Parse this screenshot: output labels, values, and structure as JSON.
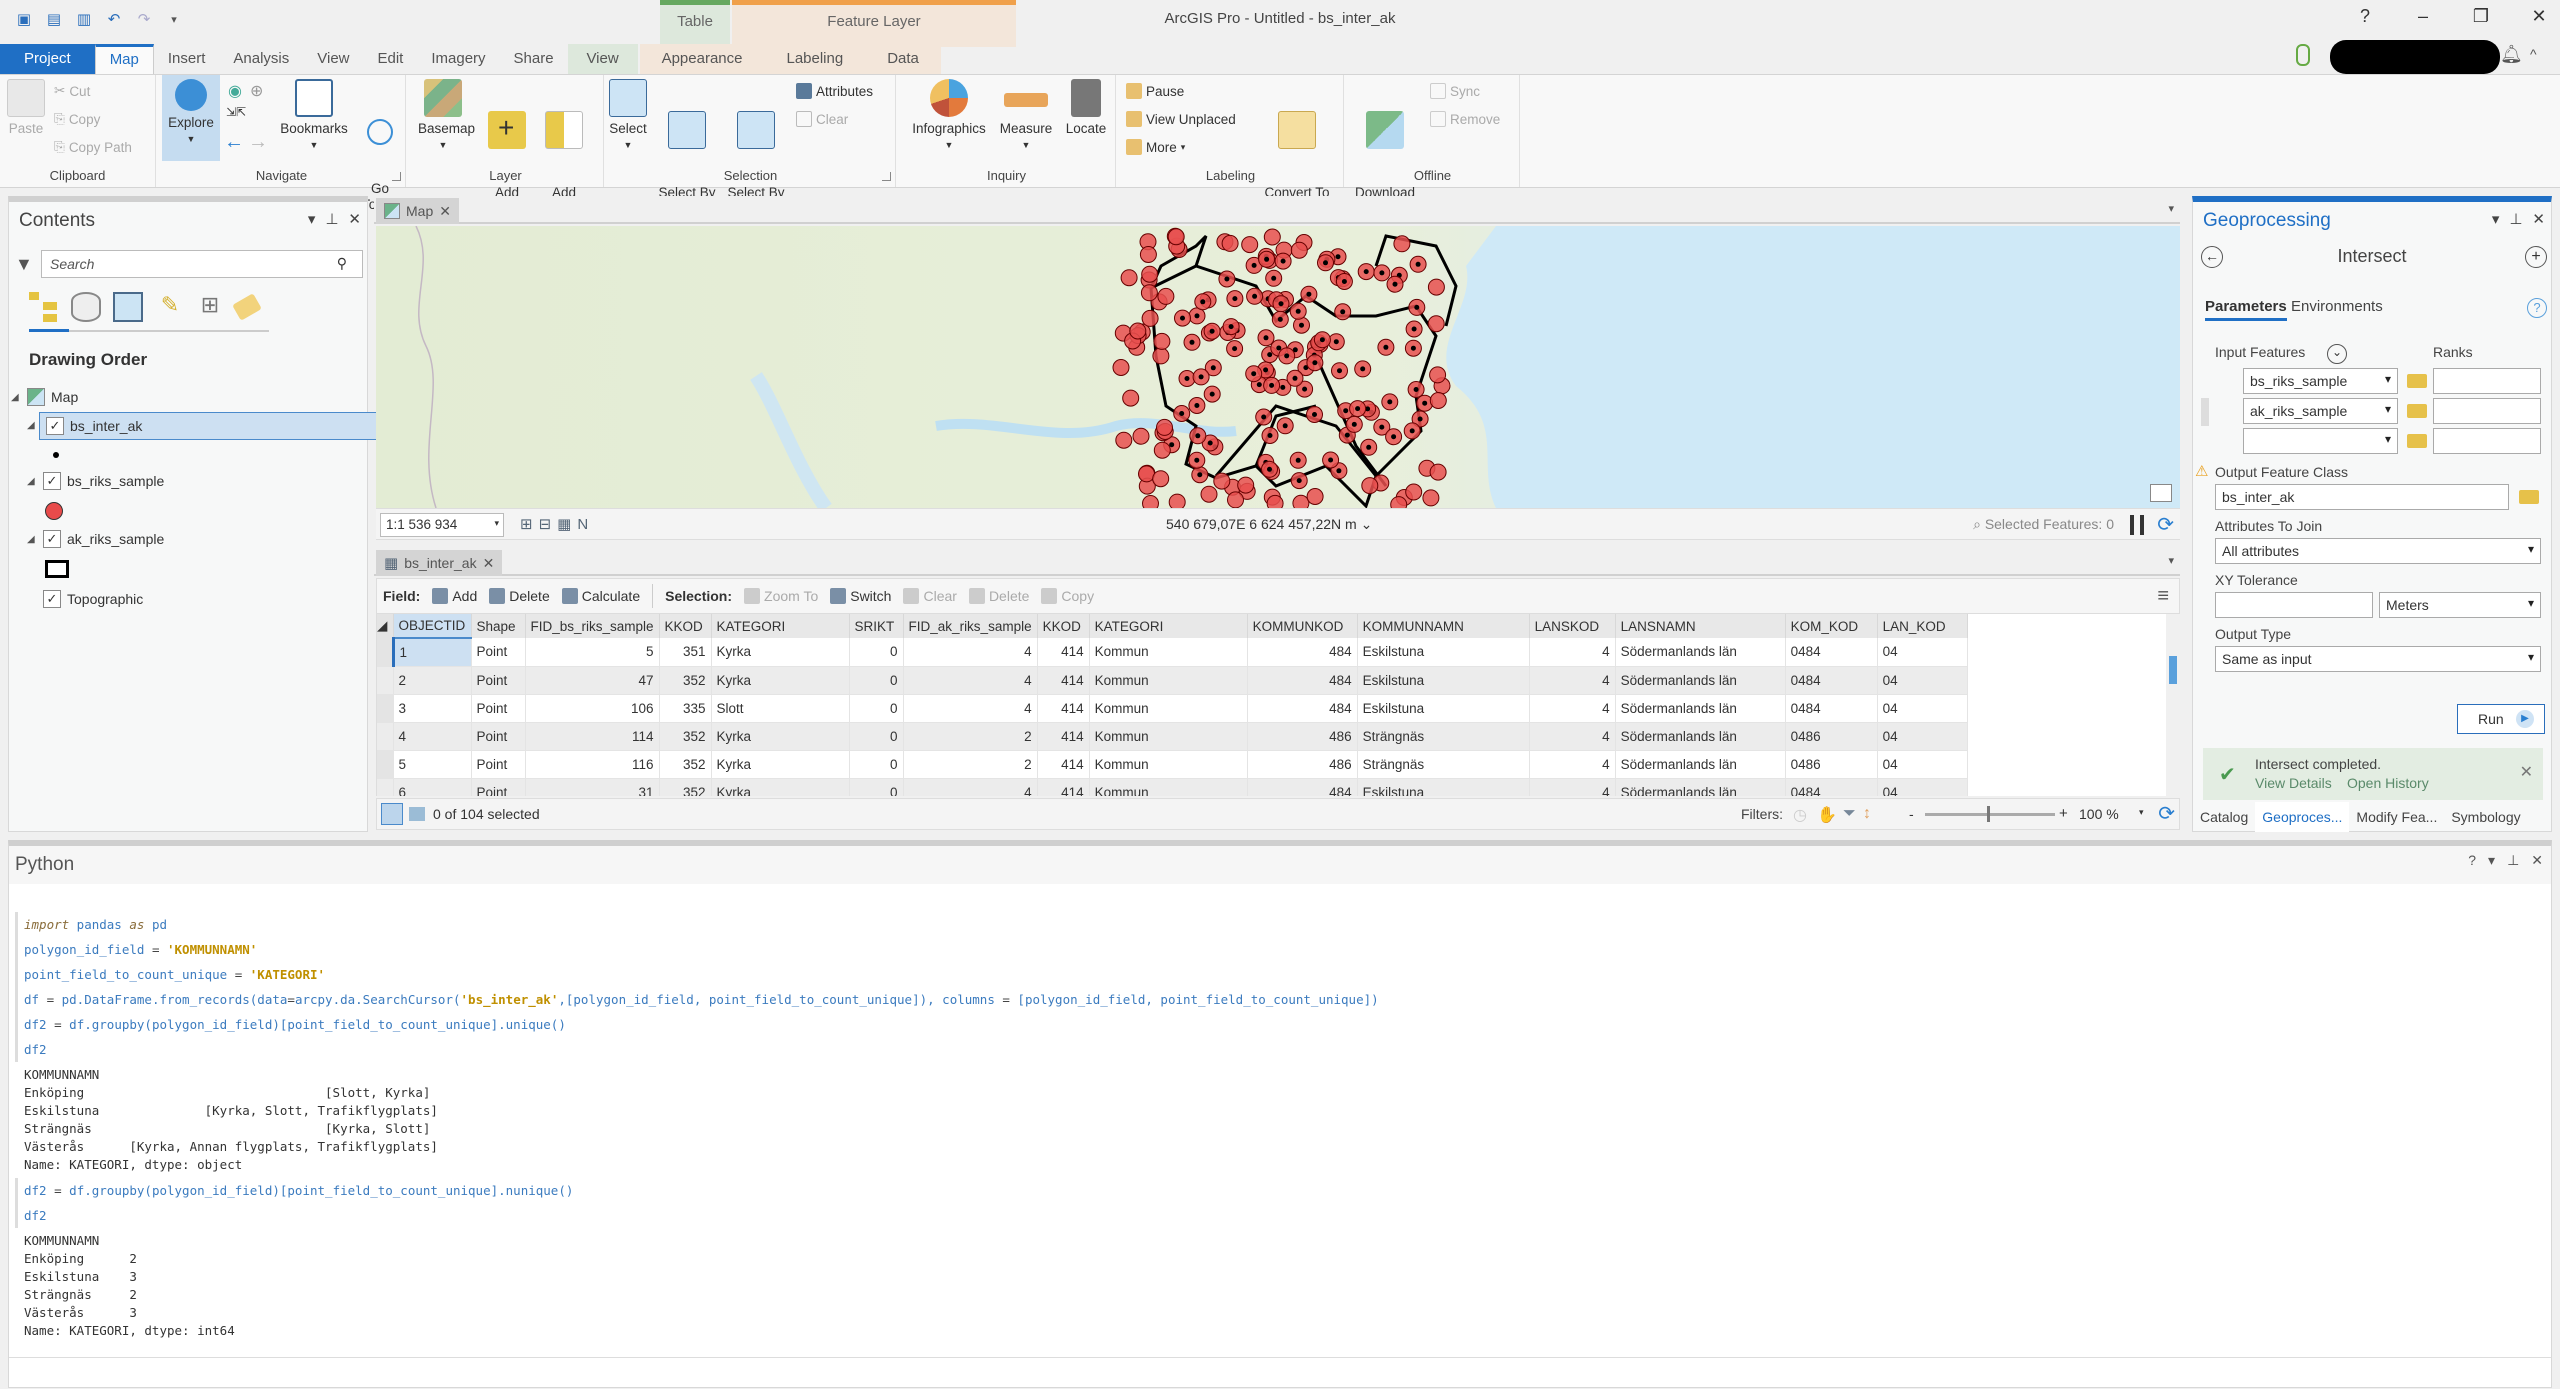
{
  "window": {
    "title": "ArcGIS Pro - Untitled - bs_inter_ak",
    "controls": [
      "?",
      "–",
      "❐",
      "✕"
    ]
  },
  "contextual_headers": {
    "table": "Table",
    "feature_layer": "Feature Layer"
  },
  "ribbon_tabs": [
    {
      "label": "Project"
    },
    {
      "label": "Map"
    },
    {
      "label": "Insert"
    },
    {
      "label": "Analysis"
    },
    {
      "label": "View"
    },
    {
      "label": "Edit"
    },
    {
      "label": "Imagery"
    },
    {
      "label": "Share"
    },
    {
      "label": "View"
    },
    {
      "label": "Appearance"
    },
    {
      "label": "Labeling"
    },
    {
      "label": "Data"
    }
  ],
  "ribbon": {
    "clipboard": {
      "label": "Clipboard",
      "paste": "Paste",
      "cut": "Cut",
      "copy": "Copy",
      "copy_path": "Copy Path"
    },
    "navigate": {
      "label": "Navigate",
      "explore": "Explore",
      "bookmarks": "Bookmarks",
      "go_to_xy": "Go\nTo XY"
    },
    "layer": {
      "label": "Layer",
      "basemap": "Basemap",
      "add_data": "Add\nData",
      "add_preset": "Add\nPreset"
    },
    "selection": {
      "label": "Selection",
      "select": "Select",
      "select_by_attributes": "Select By\nAttributes",
      "select_by_location": "Select By\nLocation",
      "attributes": "Attributes",
      "clear": "Clear"
    },
    "inquiry": {
      "label": "Inquiry",
      "infographics": "Infographics",
      "measure": "Measure",
      "locate": "Locate"
    },
    "labeling": {
      "label": "Labeling",
      "pause": "Pause",
      "view_unplaced": "View Unplaced",
      "more": "More",
      "convert": "Convert To\nAnnotation"
    },
    "offline": {
      "label": "Offline",
      "download_map": "Download\nMap",
      "sync": "Sync",
      "remove": "Remove"
    }
  },
  "contents": {
    "title": "Contents",
    "search_placeholder": "Search",
    "heading": "Drawing Order",
    "map_label": "Map",
    "layers": [
      {
        "name": "bs_inter_ak",
        "checked": true,
        "selected": true
      },
      {
        "name": "bs_riks_sample",
        "checked": true
      },
      {
        "name": "ak_riks_sample",
        "checked": true
      },
      {
        "name": "Topographic",
        "checked": true
      }
    ]
  },
  "map_view": {
    "tab_label": "Map",
    "scale": "1:1 536 934",
    "coordinates": "540 679,07E 6 624 457,22N m",
    "selected_features": "Selected Features: 0"
  },
  "table_view": {
    "tab_label": "bs_inter_ak",
    "toolbar": {
      "field_label": "Field:",
      "add": "Add",
      "delete": "Delete",
      "calculate": "Calculate",
      "selection_label": "Selection:",
      "zoom_to": "Zoom To",
      "switch": "Switch",
      "clear": "Clear",
      "sel_delete": "Delete",
      "copy": "Copy"
    },
    "columns": [
      "OBJECTID",
      "Shape",
      "FID_bs_riks_sample",
      "KKOD",
      "KATEGORI",
      "SRIKT",
      "FID_ak_riks_sample",
      "KKOD",
      "KATEGORI",
      "KOMMUNKOD",
      "KOMMUNNAMN",
      "LANSKOD",
      "LANSNAMN",
      "KOM_KOD",
      "LAN_KOD"
    ],
    "rows": [
      [
        "1",
        "Point",
        "5",
        "351",
        "Kyrka",
        "0",
        "4",
        "414",
        "Kommun",
        "484",
        "Eskilstuna",
        "4",
        "Södermanlands län",
        "0484",
        "04"
      ],
      [
        "2",
        "Point",
        "47",
        "352",
        "Kyrka",
        "0",
        "4",
        "414",
        "Kommun",
        "484",
        "Eskilstuna",
        "4",
        "Södermanlands län",
        "0484",
        "04"
      ],
      [
        "3",
        "Point",
        "106",
        "335",
        "Slott",
        "0",
        "4",
        "414",
        "Kommun",
        "484",
        "Eskilstuna",
        "4",
        "Södermanlands län",
        "0484",
        "04"
      ],
      [
        "4",
        "Point",
        "114",
        "352",
        "Kyrka",
        "0",
        "2",
        "414",
        "Kommun",
        "486",
        "Strängnäs",
        "4",
        "Södermanlands län",
        "0486",
        "04"
      ],
      [
        "5",
        "Point",
        "116",
        "352",
        "Kyrka",
        "0",
        "2",
        "414",
        "Kommun",
        "486",
        "Strängnäs",
        "4",
        "Södermanlands län",
        "0486",
        "04"
      ],
      [
        "6",
        "Point",
        "31",
        "352",
        "Kyrka",
        "0",
        "4",
        "414",
        "Kommun",
        "484",
        "Eskilstuna",
        "4",
        "Södermanlands län",
        "0484",
        "04"
      ]
    ],
    "selection_status": "0 of 104 selected",
    "filters_label": "Filters:",
    "zoom": "100 %"
  },
  "geoprocessing": {
    "title": "Geoprocessing",
    "tool": "Intersect",
    "tabs": [
      "Parameters",
      "Environments"
    ],
    "input_features_label": "Input Features",
    "ranks_label": "Ranks",
    "inputs": [
      "bs_riks_sample",
      "ak_riks_sample",
      ""
    ],
    "output_label": "Output Feature Class",
    "output_value": "bs_inter_ak",
    "attributes_label": "Attributes To Join",
    "attributes_value": "All attributes",
    "xy_label": "XY Tolerance",
    "xy_value": "",
    "xy_unit": "Meters",
    "output_type_label": "Output Type",
    "output_type_value": "Same as input",
    "run": "Run",
    "message": "Intersect completed.",
    "view_details": "View Details",
    "open_history": "Open History",
    "bottom_tabs": [
      "Catalog",
      "Geoproces...",
      "Modify Fea...",
      "Symbology"
    ]
  },
  "python": {
    "title": "Python",
    "blocks": [
      {
        "type": "in",
        "html": "<span class=\"kw\">import</span> pandas <span class=\"kw\">as</span> pd"
      },
      {
        "type": "in",
        "html": "polygon_id_field <span class=\"op\">=</span> <span class=\"str\">'KOMMUNNAMN'</span>"
      },
      {
        "type": "in",
        "html": "point_field_to_count_unique <span class=\"op\">=</span> <span class=\"str\">'KATEGORI'</span>"
      },
      {
        "type": "in",
        "html": "df <span class=\"op\">=</span> pd.DataFrame.from_records(data<span class=\"op\">=</span>arcpy.da.SearchCursor(<span class=\"str\">'bs_inter_ak'</span>,[polygon_id_field, point_field_to_count_unique]), columns <span class=\"op\">=</span> [polygon_id_field, point_field_to_count_unique])"
      },
      {
        "type": "in",
        "html": "df2 <span class=\"op\">=</span> df.groupby(polygon_id_field)[point_field_to_count_unique].unique()"
      },
      {
        "type": "in",
        "html": "df2"
      },
      {
        "type": "out",
        "text": "KOMMUNNAMN\nEnköping                                [Slott, Kyrka]\nEskilstuna              [Kyrka, Slott, Trafikflygplats]\nSträngnäs                               [Kyrka, Slott]\nVästerås      [Kyrka, Annan flygplats, Trafikflygplats]\nName: KATEGORI, dtype: object"
      },
      {
        "type": "in",
        "html": "df2 <span class=\"op\">=</span> df.groupby(polygon_id_field)[point_field_to_count_unique].nunique()"
      },
      {
        "type": "in",
        "html": "df2"
      },
      {
        "type": "out",
        "text": "KOMMUNNAMN\nEnköping      2\nEskilstuna    3\nSträngnäs     2\nVästerås      3\nName: KATEGORI, dtype: int64"
      }
    ]
  }
}
